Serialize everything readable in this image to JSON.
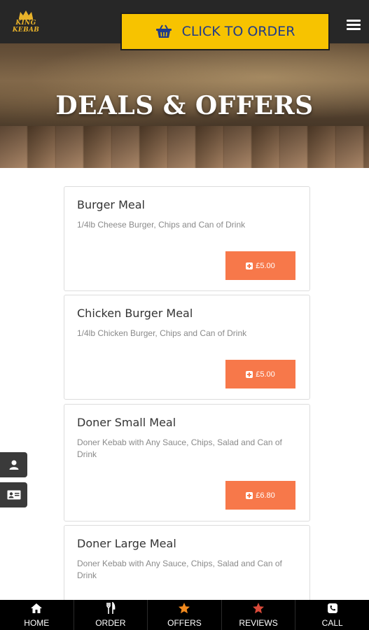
{
  "header": {
    "logo_line1": "KING",
    "logo_line2": "KEBAB",
    "order_button_label": "CLICK TO ORDER"
  },
  "hero": {
    "title": "DEALS & OFFERS"
  },
  "deals": [
    {
      "name": "Burger Meal",
      "description": "1/4lb Cheese Burger, Chips and Can of Drink",
      "price": "£5.00"
    },
    {
      "name": "Chicken Burger Meal",
      "description": "1/4lb Chicken Burger, Chips and Can of Drink",
      "price": "£5.00"
    },
    {
      "name": "Doner Small Meal",
      "description": "Doner Kebab with Any Sauce, Chips, Salad and Can of Drink",
      "price": "£6.80"
    },
    {
      "name": "Doner Large Meal",
      "description": "Doner Kebab with Any Sauce, Chips, Salad and Can of Drink",
      "price": ""
    }
  ],
  "side_tabs": [
    {
      "icon": "user-icon"
    },
    {
      "icon": "contact-card-icon"
    }
  ],
  "bottom_nav": [
    {
      "label": "HOME",
      "icon": "home-icon"
    },
    {
      "label": "ORDER",
      "icon": "cutlery-icon"
    },
    {
      "label": "OFFERS",
      "icon": "star-icon"
    },
    {
      "label": "REVIEWS",
      "icon": "star-icon"
    },
    {
      "label": "CALL",
      "icon": "phone-icon"
    }
  ],
  "colors": {
    "header_bg": "#272727",
    "order_button_bg": "#f7c300",
    "order_button_text": "#1f3b8a",
    "price_button_bg": "#f7784a",
    "offers_star": "#f28a1e",
    "reviews_star": "#d94a3a",
    "nav_bg": "#000000"
  }
}
